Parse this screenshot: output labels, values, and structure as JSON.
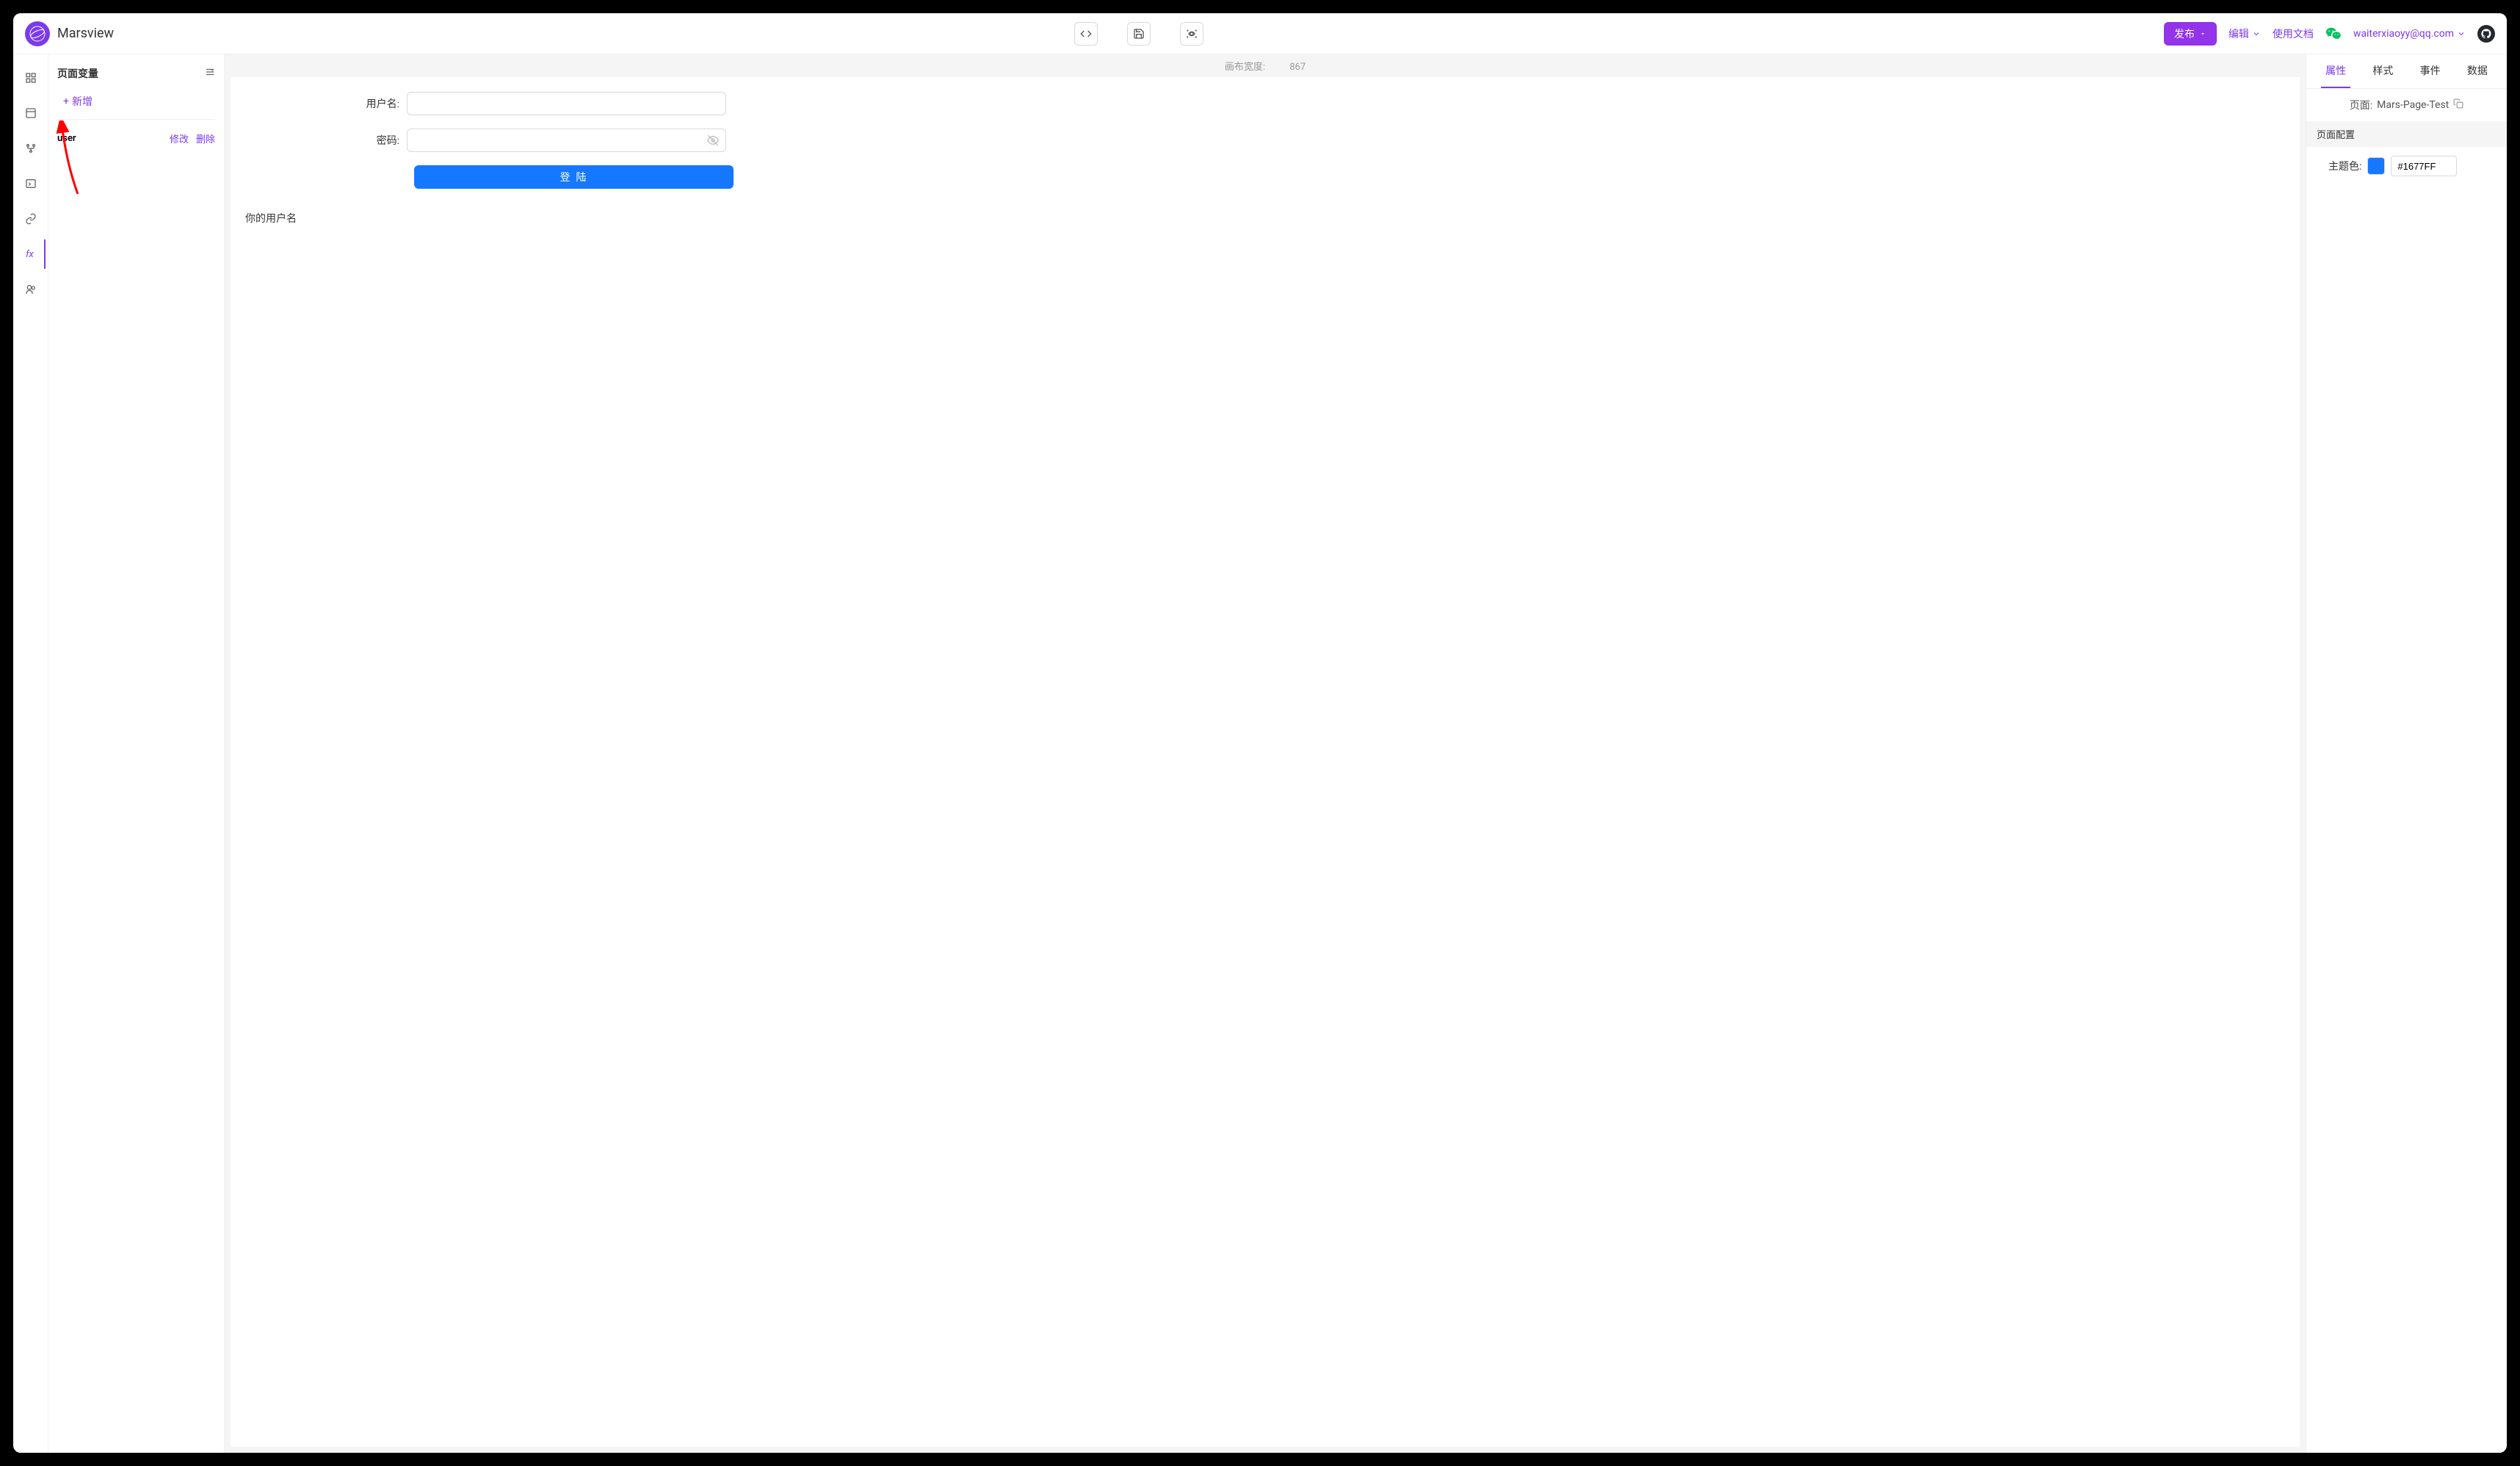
{
  "header": {
    "brand": "Marsview",
    "publish": "发布",
    "edit": "编辑",
    "docs": "使用文档",
    "user_email": "waiterxiaoyy@qq.com"
  },
  "var_panel": {
    "title": "页面变量",
    "add": "新增",
    "variables": [
      {
        "name": "user",
        "actions": {
          "edit": "修改",
          "delete": "删除"
        }
      }
    ]
  },
  "canvas": {
    "width_label": "画布宽度:",
    "width_value": "867",
    "form": {
      "username_label": "用户名:",
      "password_label": "密码:",
      "login_button": "登 陆"
    },
    "body_text": "你的用户名"
  },
  "right_panel": {
    "tabs": {
      "attr": "属性",
      "style": "样式",
      "event": "事件",
      "data": "数据"
    },
    "page_label": "页面:",
    "page_name": "Mars-Page-Test",
    "config_title": "页面配置",
    "theme_label": "主题色:",
    "theme_color": "#1677FF"
  }
}
